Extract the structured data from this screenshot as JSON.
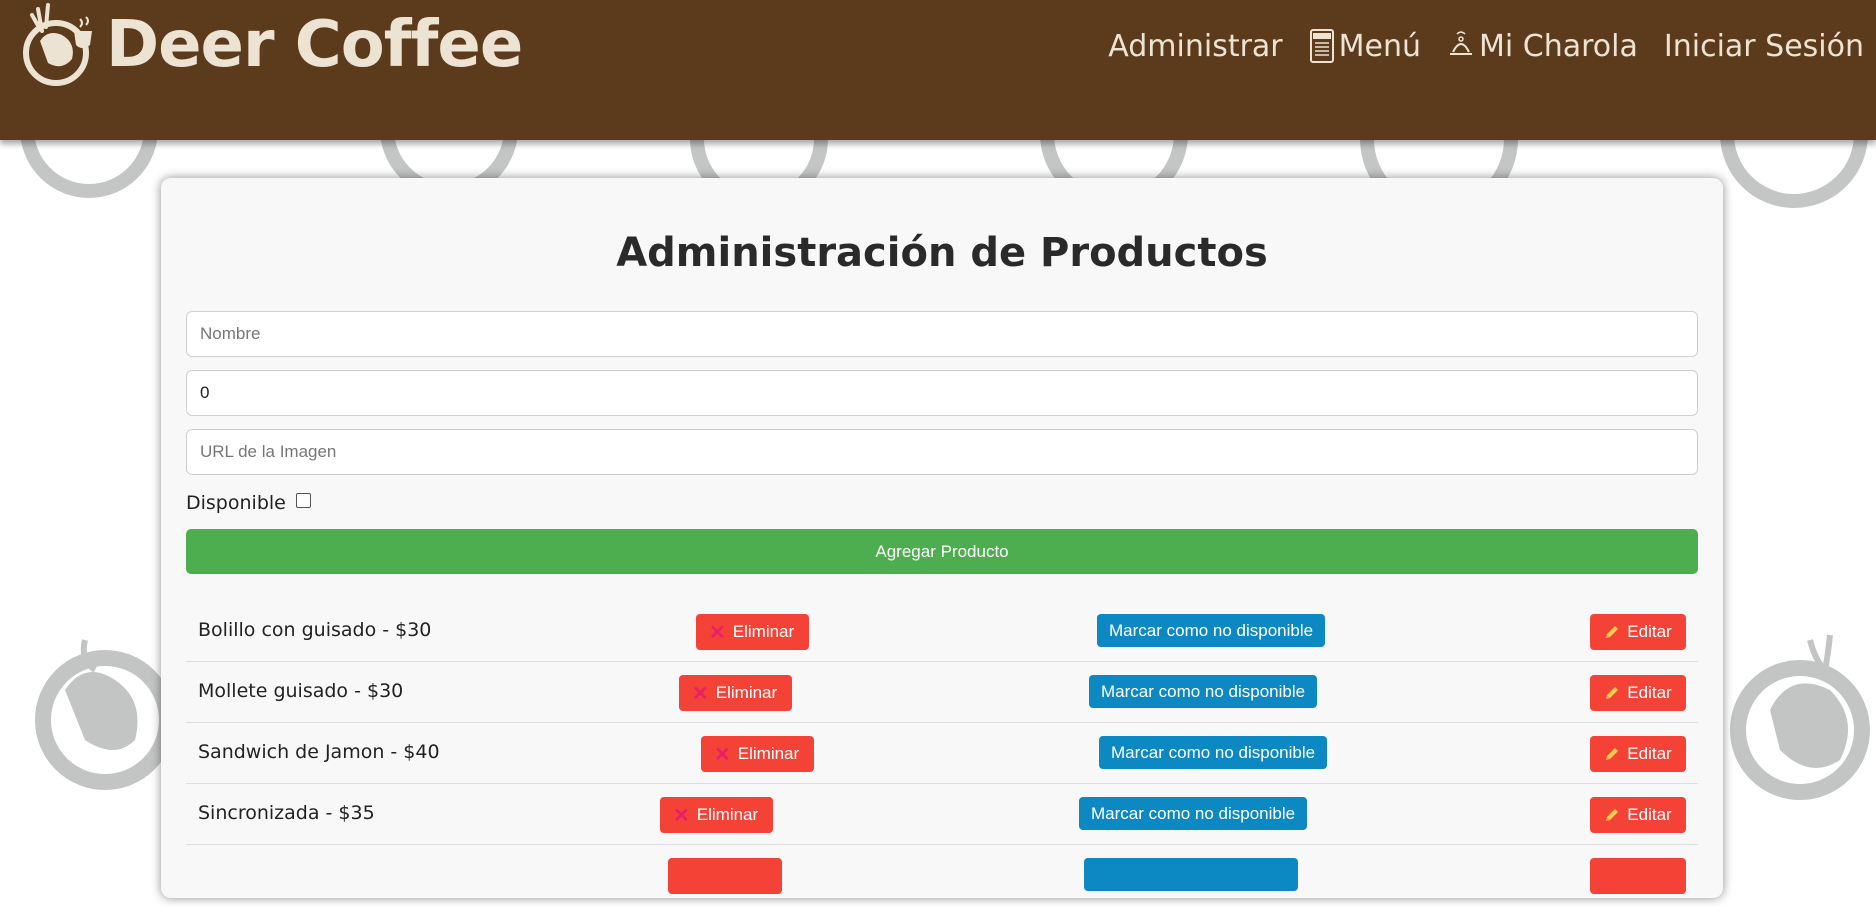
{
  "header": {
    "brand": "Deer Coffee",
    "nav": [
      {
        "label": "Administrar",
        "icon": "none"
      },
      {
        "label": "Menú",
        "icon": "menu-card-icon"
      },
      {
        "label": "Mi Charola",
        "icon": "serving-tray-icon"
      },
      {
        "label": "Iniciar Sesión",
        "icon": "none"
      }
    ]
  },
  "admin": {
    "title": "Administración de Productos",
    "name_placeholder": "Nombre",
    "price_value": "0",
    "image_placeholder": "URL de la Imagen",
    "available_label": "Disponible",
    "available_checked": false,
    "add_button": "Agregar Producto"
  },
  "products": [
    {
      "label": "Bolillo con guisado - $30",
      "delete": "Eliminar",
      "mark": "Marcar como no disponible",
      "edit": "Editar"
    },
    {
      "label": "Mollete guisado - $30",
      "delete": "Eliminar",
      "mark": "Marcar como no disponible",
      "edit": "Editar"
    },
    {
      "label": "Sandwich de Jamon - $40",
      "delete": "Eliminar",
      "mark": "Marcar como no disponible",
      "edit": "Editar"
    },
    {
      "label": "Sincronizada - $35",
      "delete": "Eliminar",
      "mark": "Marcar como no disponible",
      "edit": "Editar"
    },
    {
      "label": "",
      "delete": "",
      "mark": "",
      "edit": ""
    }
  ],
  "colors": {
    "header_bg": "#5c3a1c",
    "header_text": "#ece3d3",
    "add_button": "#4cae4f",
    "delete_button": "#f44336",
    "mark_button": "#0c88c2",
    "edit_button": "#f44336"
  }
}
